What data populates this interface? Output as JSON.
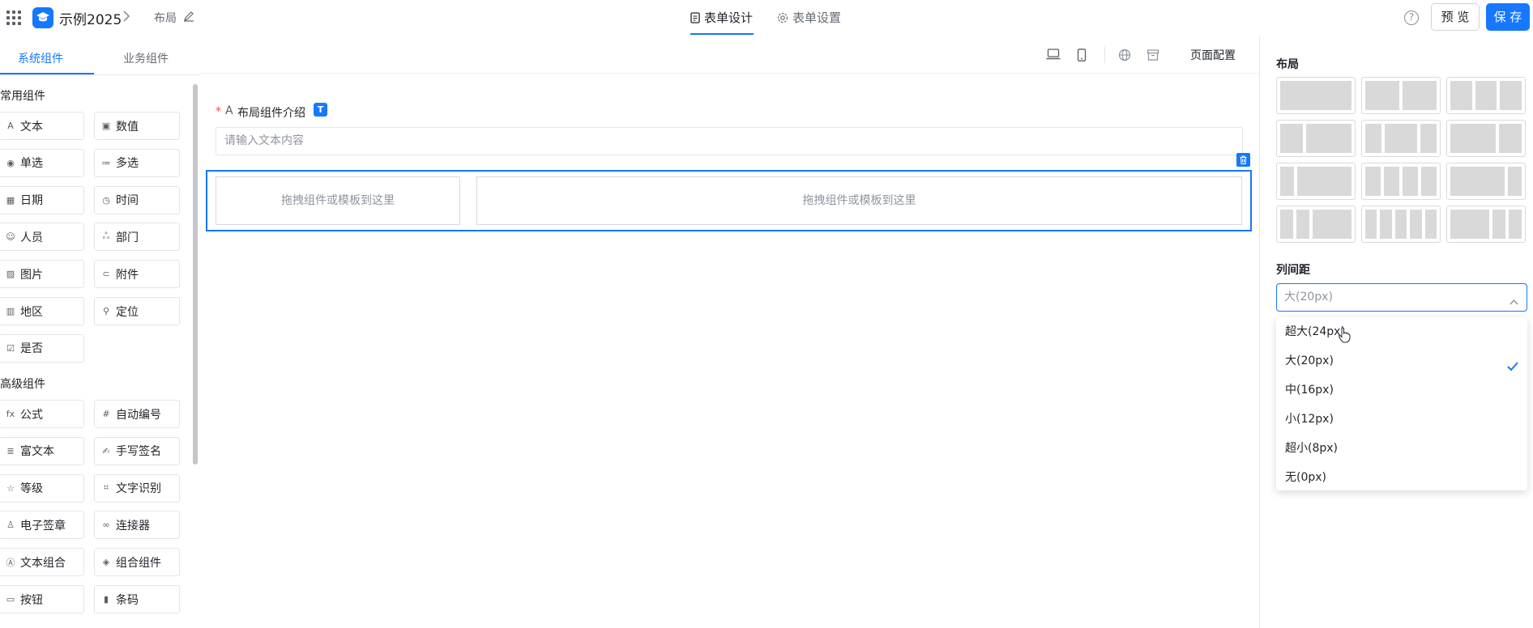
{
  "header": {
    "app_title": "示例2025",
    "breadcrumb": "布局",
    "tabs": [
      {
        "label": "表单设计",
        "active": true
      },
      {
        "label": "表单设置",
        "active": false
      }
    ],
    "preview_label": "预 览",
    "save_label": "保 存"
  },
  "left_panel": {
    "tabs": [
      {
        "label": "系统组件",
        "active": true
      },
      {
        "label": "业务组件",
        "active": false
      }
    ],
    "groups": [
      {
        "title": "常用组件",
        "items": [
          {
            "label": "文本",
            "icon": "text-icon"
          },
          {
            "label": "数值",
            "icon": "number-icon"
          },
          {
            "label": "单选",
            "icon": "radio-icon"
          },
          {
            "label": "多选",
            "icon": "checklist-icon"
          },
          {
            "label": "日期",
            "icon": "calendar-icon"
          },
          {
            "label": "时间",
            "icon": "clock-icon"
          },
          {
            "label": "人员",
            "icon": "person-icon"
          },
          {
            "label": "部门",
            "icon": "org-icon"
          },
          {
            "label": "图片",
            "icon": "image-icon"
          },
          {
            "label": "附件",
            "icon": "attachment-icon"
          },
          {
            "label": "地区",
            "icon": "map-icon"
          },
          {
            "label": "定位",
            "icon": "location-pin-icon"
          },
          {
            "label": "是否",
            "icon": "checkbox-icon"
          }
        ]
      },
      {
        "title": "高级组件",
        "items": [
          {
            "label": "公式",
            "icon": "formula-icon"
          },
          {
            "label": "自动编号",
            "icon": "hash-icon"
          },
          {
            "label": "富文本",
            "icon": "rich-text-icon"
          },
          {
            "label": "手写签名",
            "icon": "signature-icon"
          },
          {
            "label": "等级",
            "icon": "star-icon"
          },
          {
            "label": "文字识别",
            "icon": "ocr-icon"
          },
          {
            "label": "电子签章",
            "icon": "stamp-icon"
          },
          {
            "label": "连接器",
            "icon": "link-icon"
          },
          {
            "label": "文本组合",
            "icon": "text-combo-icon"
          },
          {
            "label": "组合组件",
            "icon": "combo-icon"
          },
          {
            "label": "按钮",
            "icon": "button-icon"
          },
          {
            "label": "条码",
            "icon": "barcode-icon"
          }
        ]
      }
    ]
  },
  "canvas": {
    "toolbar": {
      "page_config_label": "页面配置"
    },
    "field": {
      "label": "布局组件介绍",
      "placeholder": "请输入文本内容",
      "badge": "T"
    },
    "drop_zone_text": "拖拽组件或模板到这里"
  },
  "right_panel": {
    "layout_title": "布局",
    "gap_title": "列间距",
    "gap_select": {
      "value": "大(20px)",
      "options": [
        "超大(24px)",
        "大(20px)",
        "中(16px)",
        "小(12px)",
        "超小(8px)",
        "无(0px)"
      ],
      "selected_index": 1
    }
  },
  "colors": {
    "accent": "#1677ff",
    "required": "#f54a45"
  }
}
